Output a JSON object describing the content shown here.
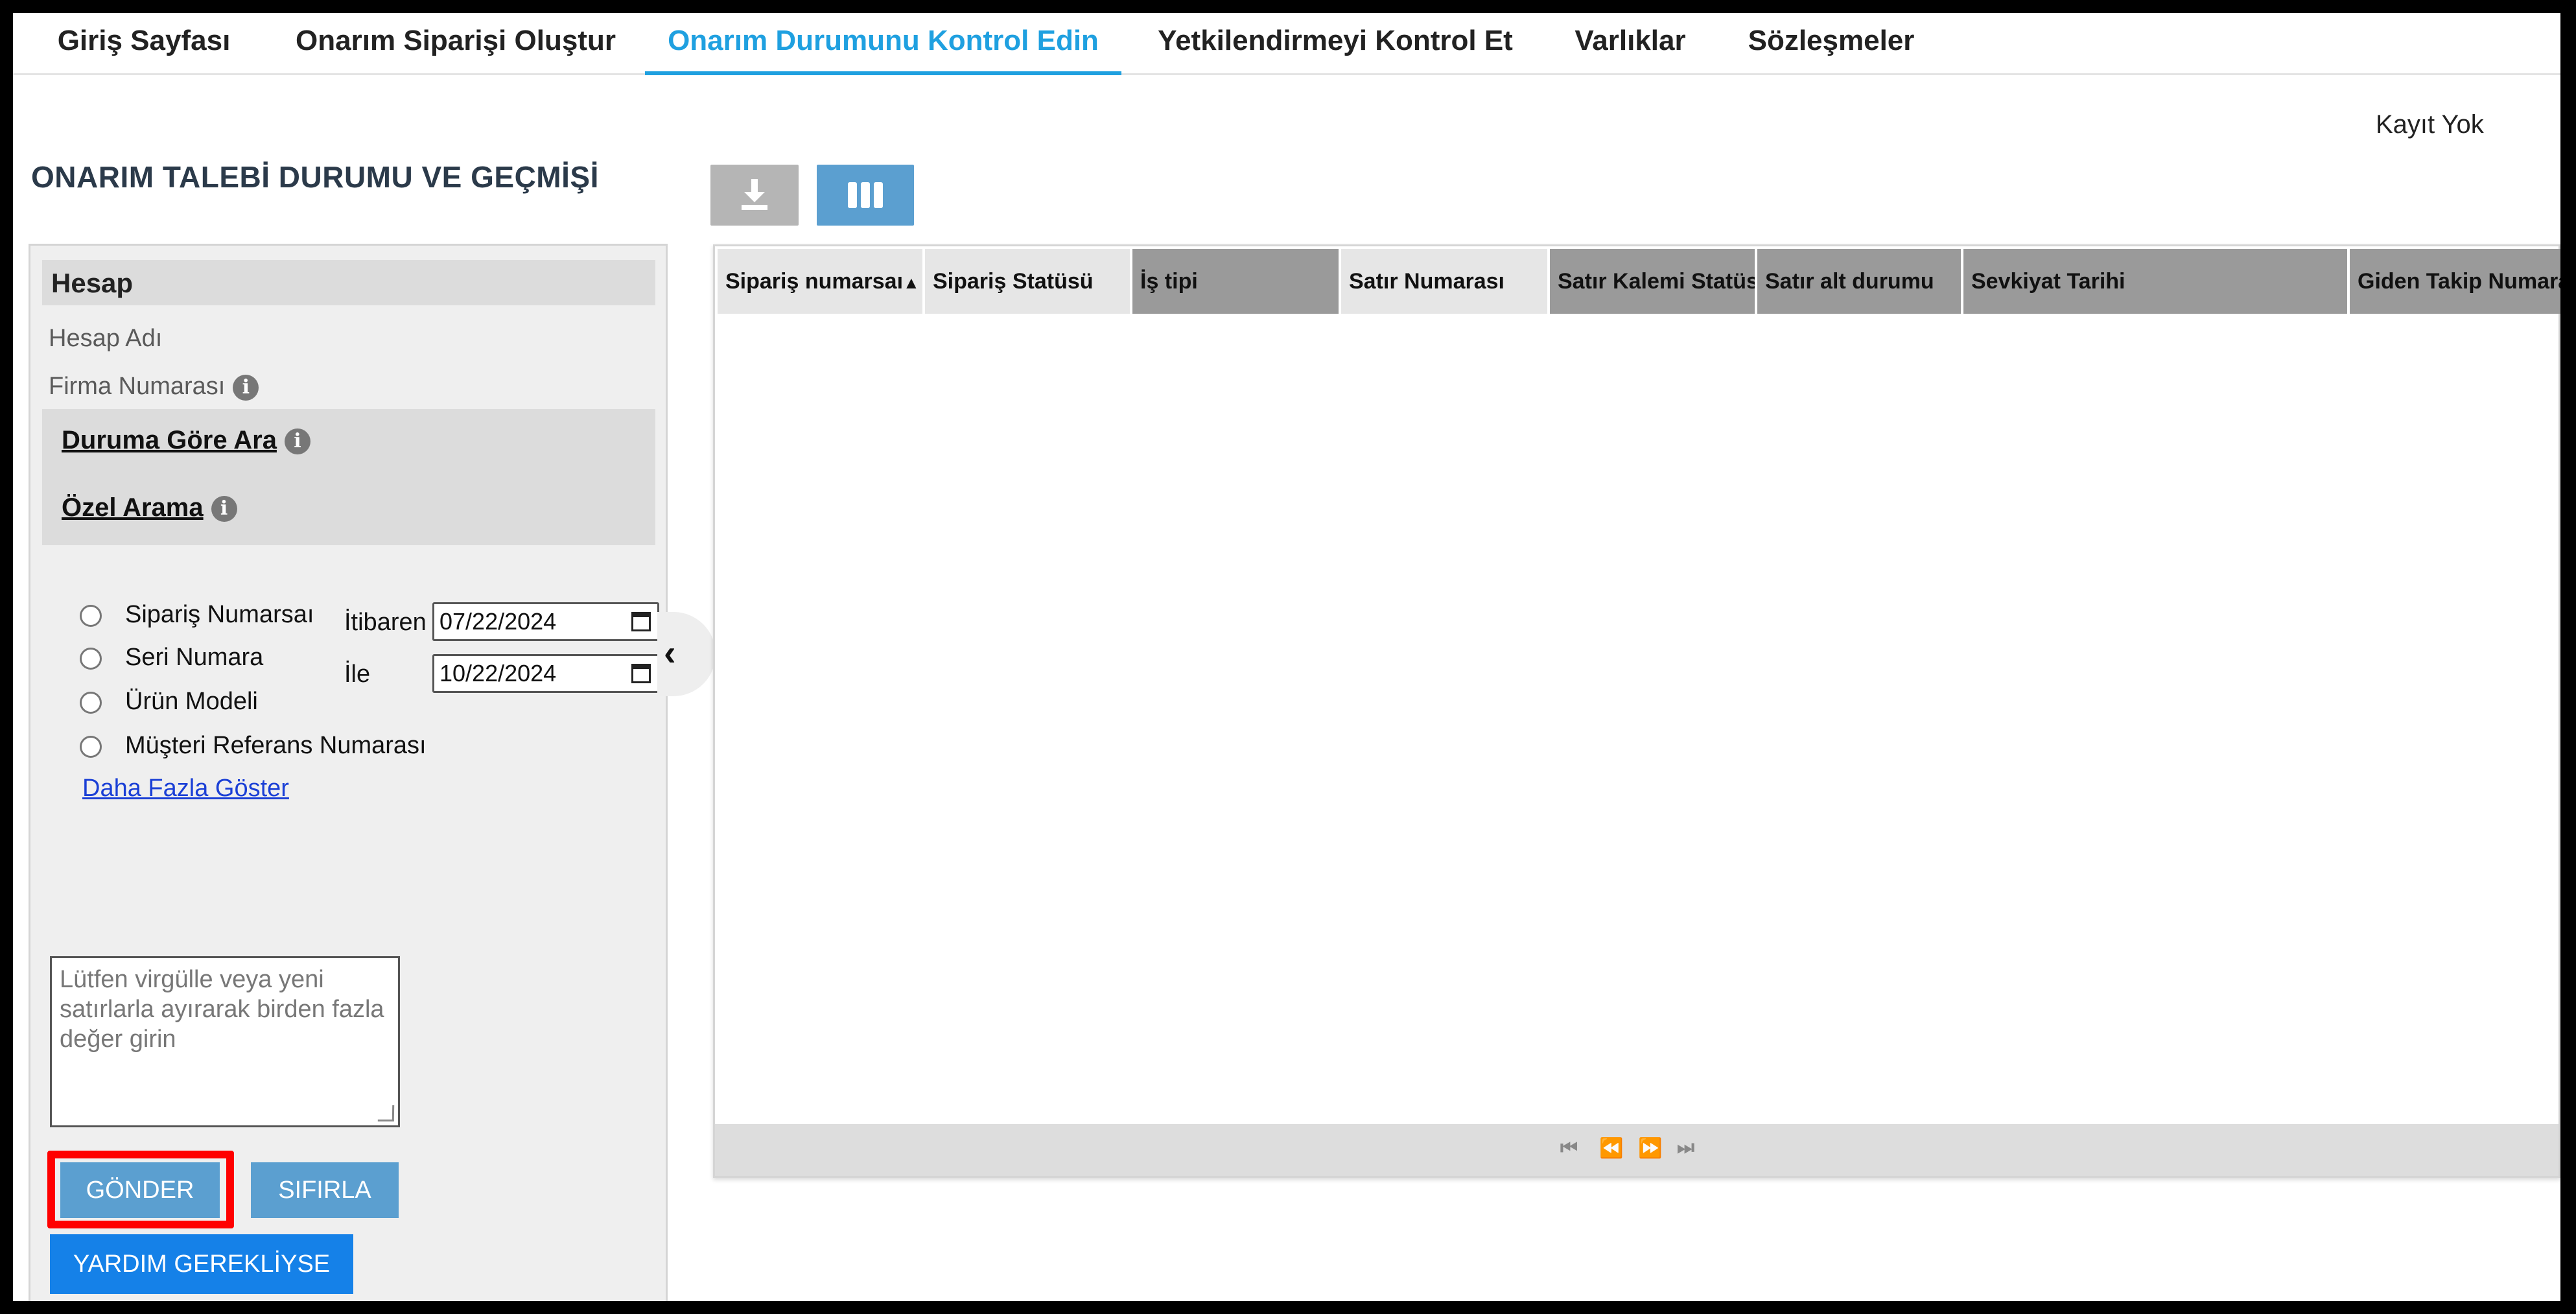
{
  "nav": {
    "tabs": [
      {
        "label": "Giriş Sayfası"
      },
      {
        "label": "Onarım Siparişi Oluştur"
      },
      {
        "label": "Onarım Durumunu Kontrol Edin"
      },
      {
        "label": "Yetkilendirmeyi Kontrol Et"
      },
      {
        "label": "Varlıklar"
      },
      {
        "label": "Sözleşmeler"
      }
    ],
    "active_index": 2
  },
  "page": {
    "title": "ONARIM TALEBİ DURUMU VE GEÇMİŞİ",
    "record_status": "Kayıt Yok"
  },
  "filter": {
    "account_header": "Hesap",
    "account_name_label": "Hesap Adı",
    "company_number_label": "Firma Numarası",
    "search_by_status": "Duruma Göre Ara",
    "custom_search": "Özel Arama",
    "radio_options": [
      {
        "label": "Sipariş Numarsaı"
      },
      {
        "label": "Seri Numara"
      },
      {
        "label": "Ürün Modeli"
      },
      {
        "label": "Müşteri Referans Numarası"
      }
    ],
    "from_label": "İtibaren",
    "from_date": "07/22/2024",
    "to_label": "İle",
    "to_date": "10/22/2024",
    "show_more": "Daha Fazla Göster",
    "multi_value_placeholder": "Lütfen virgülle veya yeni satırlarla ayırarak birden fazla değer girin",
    "submit_label": "GÖNDER",
    "reset_label": "SIFIRLA",
    "help_label": "YARDIM GEREKLİYSE"
  },
  "grid": {
    "columns": [
      {
        "label": "Sipariş numarsaı",
        "sorted": "asc"
      },
      {
        "label": "Sipariş Statüsü"
      },
      {
        "label": "İş tipi"
      },
      {
        "label": "Satır Numarası"
      },
      {
        "label": "Satır Kalemi Statüsü"
      },
      {
        "label": "Satır alt durumu"
      },
      {
        "label": "Sevkiyat Tarihi"
      },
      {
        "label": "Giden Takip Numarası"
      }
    ],
    "rows": []
  },
  "colors": {
    "accent": "#1fa0e0",
    "button_blue": "#5b9fd0",
    "help_blue": "#1581e8",
    "highlight_red": "#ff0000",
    "disabled_gray": "#b5b5b5"
  },
  "icons": {
    "download": "download-icon",
    "columns": "columns-icon",
    "info": "info-icon",
    "calendar": "calendar-icon",
    "collapse": "chevron-left-icon"
  }
}
